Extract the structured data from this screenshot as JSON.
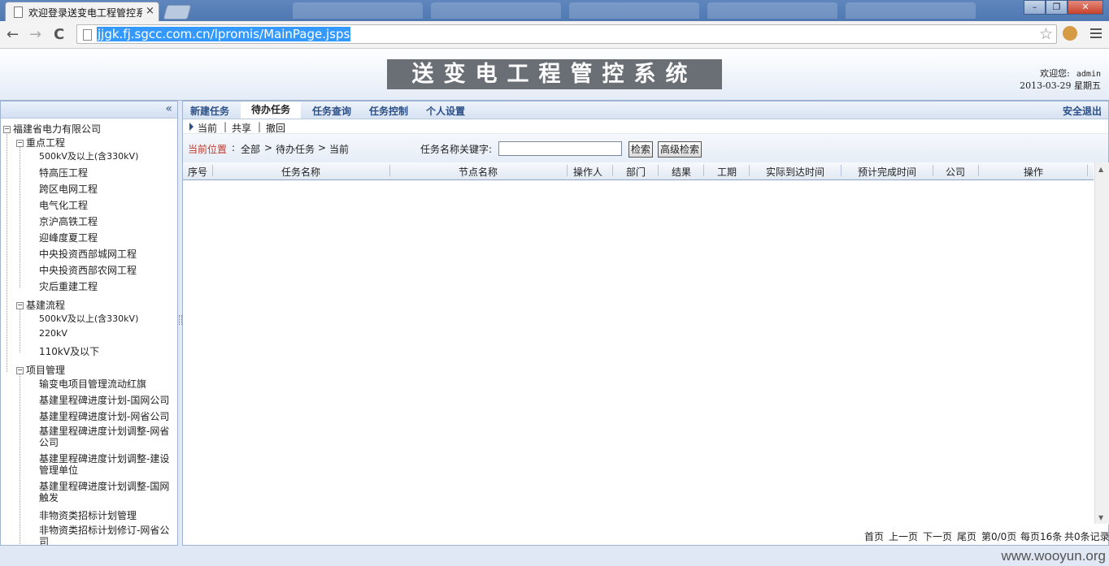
{
  "browser": {
    "tab_title": "欢迎登录送变电工程管控系",
    "tab_close": "×",
    "url": "jjgk.fj.sgcc.com.cn/lpromis/MainPage.jsps",
    "back": "←",
    "forward": "→",
    "reload": "C",
    "star": "☆",
    "win_min": "–",
    "win_max": "❐",
    "win_close": "✕"
  },
  "header": {
    "logo_text": "送变电工程管控系统",
    "welcome_label": "欢迎您:",
    "username": "admin",
    "date": "2013-03-29",
    "weekday": "星期五"
  },
  "left_panel": {
    "collapse_icon": "«",
    "root": "福建省电力有限公司",
    "groups": [
      {
        "label": "重点工程",
        "items": [
          "500kV及以上(含330kV)",
          "特高压工程",
          "跨区电网工程",
          "电气化工程",
          "京沪高铁工程",
          "迎峰度夏工程",
          "中央投资西部城网工程",
          "中央投资西部农网工程",
          "灾后重建工程"
        ]
      },
      {
        "label": "基建流程",
        "items": [
          "500kV及以上(含330kV)",
          "220kV",
          "110kV及以下"
        ]
      },
      {
        "label": "项目管理",
        "items": [
          "输变电项目管理流动红旗",
          "基建里程碑进度计划-国网公司",
          "基建里程碑进度计划-网省公司",
          "基建里程碑进度计划调整-网省公司",
          "基建里程碑进度计划调整-建设管理单位",
          "基建里程碑进度计划调整-国网触发",
          "非物资类招标计划管理",
          "非物资类招标计划修订-网省公司"
        ]
      }
    ]
  },
  "menu": {
    "items": [
      "新建任务",
      "待办任务",
      "任务查询",
      "任务控制",
      "个人设置"
    ],
    "logout": "安全退出"
  },
  "subbar": {
    "current": "当前",
    "share": "共享",
    "revoke": "撤回",
    "sep": "|"
  },
  "crumb": {
    "label": "当前位置",
    "colon": ":",
    "path": [
      "全部",
      "待办任务",
      "当前"
    ],
    "sep": ">",
    "search_label": "任务名称关键字:",
    "search_value": "",
    "search_button": "检索",
    "advanced_button": "高级检索"
  },
  "grid": {
    "columns": [
      "序号",
      "任务名称",
      "节点名称",
      "操作人",
      "部门",
      "结果",
      "工期",
      "实际到达时间",
      "预计完成时间",
      "公司",
      "操作"
    ],
    "rows": []
  },
  "pager": {
    "first": "首页",
    "prev": "上一页",
    "next": "下一页",
    "last": "尾页",
    "page_info": "第0/0页",
    "per_page": "每页16条",
    "total": "共0条记录"
  },
  "watermark": "www.wooyun.org"
}
